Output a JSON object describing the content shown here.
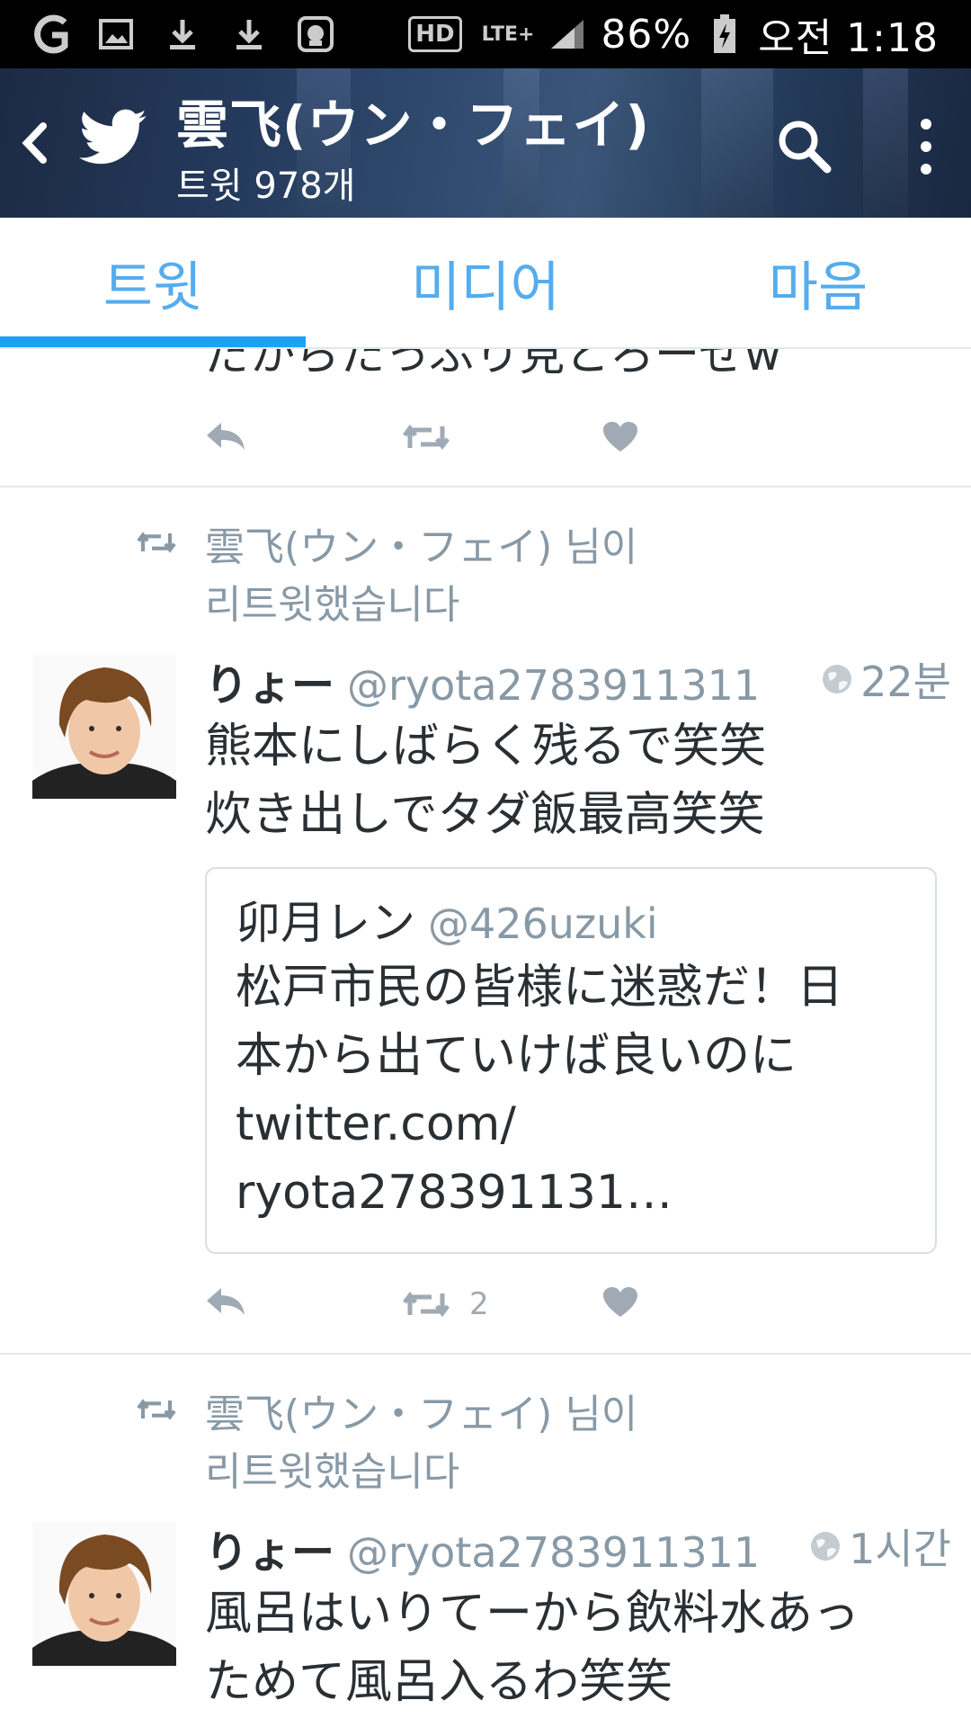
{
  "status_bar": {
    "network_badge": "HD",
    "lte_label": "LTE+",
    "battery": "86%",
    "time": "오전 1:18"
  },
  "header": {
    "title": "雲飞(ウン・フェイ)",
    "subtitle": "트윗 978개",
    "icons": [
      "back-arrow-icon",
      "twitter-bird-icon",
      "search-icon",
      "more-vertical-icon"
    ]
  },
  "tabs": [
    {
      "label": "트윗",
      "active": true
    },
    {
      "label": "미디어",
      "active": false
    },
    {
      "label": "마음",
      "active": false
    }
  ],
  "colors": {
    "accent": "#1da1f2",
    "tab_text": "#55acee",
    "secondary_text": "#8899a6",
    "icon_gray": "#a0aab4"
  },
  "feed": {
    "partial_tweet": {
      "text": "だからたっぷり見とろーぜw"
    },
    "tweets": [
      {
        "retweet_line1": "雲飞(ウン・フェイ) 님이",
        "retweet_line2": "리트윗했습니다",
        "name": "りょー",
        "handle": "@ryota2783911311",
        "time": "22분",
        "body": "熊本にしばらく残るで笑笑\n炊き出しでタダ飯最高笑笑",
        "quote": {
          "name": "卯月レン",
          "handle": "@426uzuki",
          "body": "松戸市民の皆様に迷惑だ！日\n本から出ていけば良いのに\ntwitter.com/\nryota278391131…"
        },
        "retweet_count": "2"
      },
      {
        "retweet_line1": "雲飞(ウン・フェイ) 님이",
        "retweet_line2": "리트윗했습니다",
        "name": "りょー",
        "handle": "@ryota2783911311",
        "time": "1시간",
        "body": "風呂はいりてーから飲料水あっ\nためて風呂入るわ笑笑"
      }
    ]
  }
}
